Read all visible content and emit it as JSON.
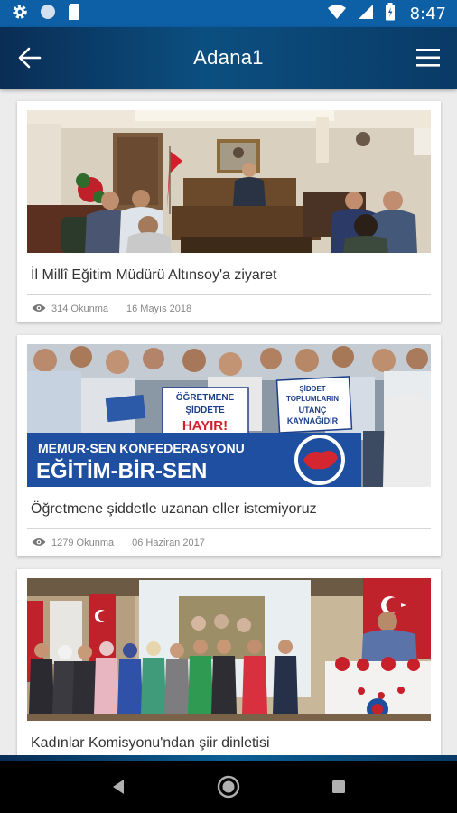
{
  "status_bar": {
    "time": "8:47"
  },
  "header": {
    "title": "Adana1"
  },
  "articles": [
    {
      "title": "İl Millî Eğitim Müdürü Altınsoy'a ziyaret",
      "views": "314 Okunma",
      "date": "16 Mayıs 2018"
    },
    {
      "title": "Öğretmene şiddetle uzanan eller istemiyoruz",
      "views": "1279 Okunma",
      "date": "06 Haziran 2017"
    },
    {
      "title": "Kadınlar Komisyonu'ndan şiir dinletisi"
    }
  ],
  "photo_texts": {
    "sign1": [
      "ÖĞRETMENE",
      "ŞİDDETE",
      "HAYIR!"
    ],
    "sign2": [
      "ŞİDDET",
      "TOPLUMLARIN",
      "UTANÇ",
      "KAYNAĞIDIR"
    ],
    "banner": [
      "MEMUR-SEN KONFEDERASYONU",
      "EĞİTİM-BİR-SEN"
    ]
  },
  "icons": {
    "settings": "gear-icon",
    "circle": "circle-status-icon",
    "sd": "sd-card-icon",
    "wifi": "wifi-icon",
    "signal": "signal-icon",
    "battery": "battery-icon",
    "back": "arrow-left-icon",
    "menu": "hamburger-menu-icon",
    "views": "eye-icon",
    "nav_back": "triangle-back-icon",
    "nav_home": "circle-home-icon",
    "nav_recent": "square-recents-icon"
  },
  "colors": {
    "status_bar": "#0d5fa6",
    "app_bar": "#0b4f80",
    "background": "#ececec",
    "card": "#ffffff"
  }
}
